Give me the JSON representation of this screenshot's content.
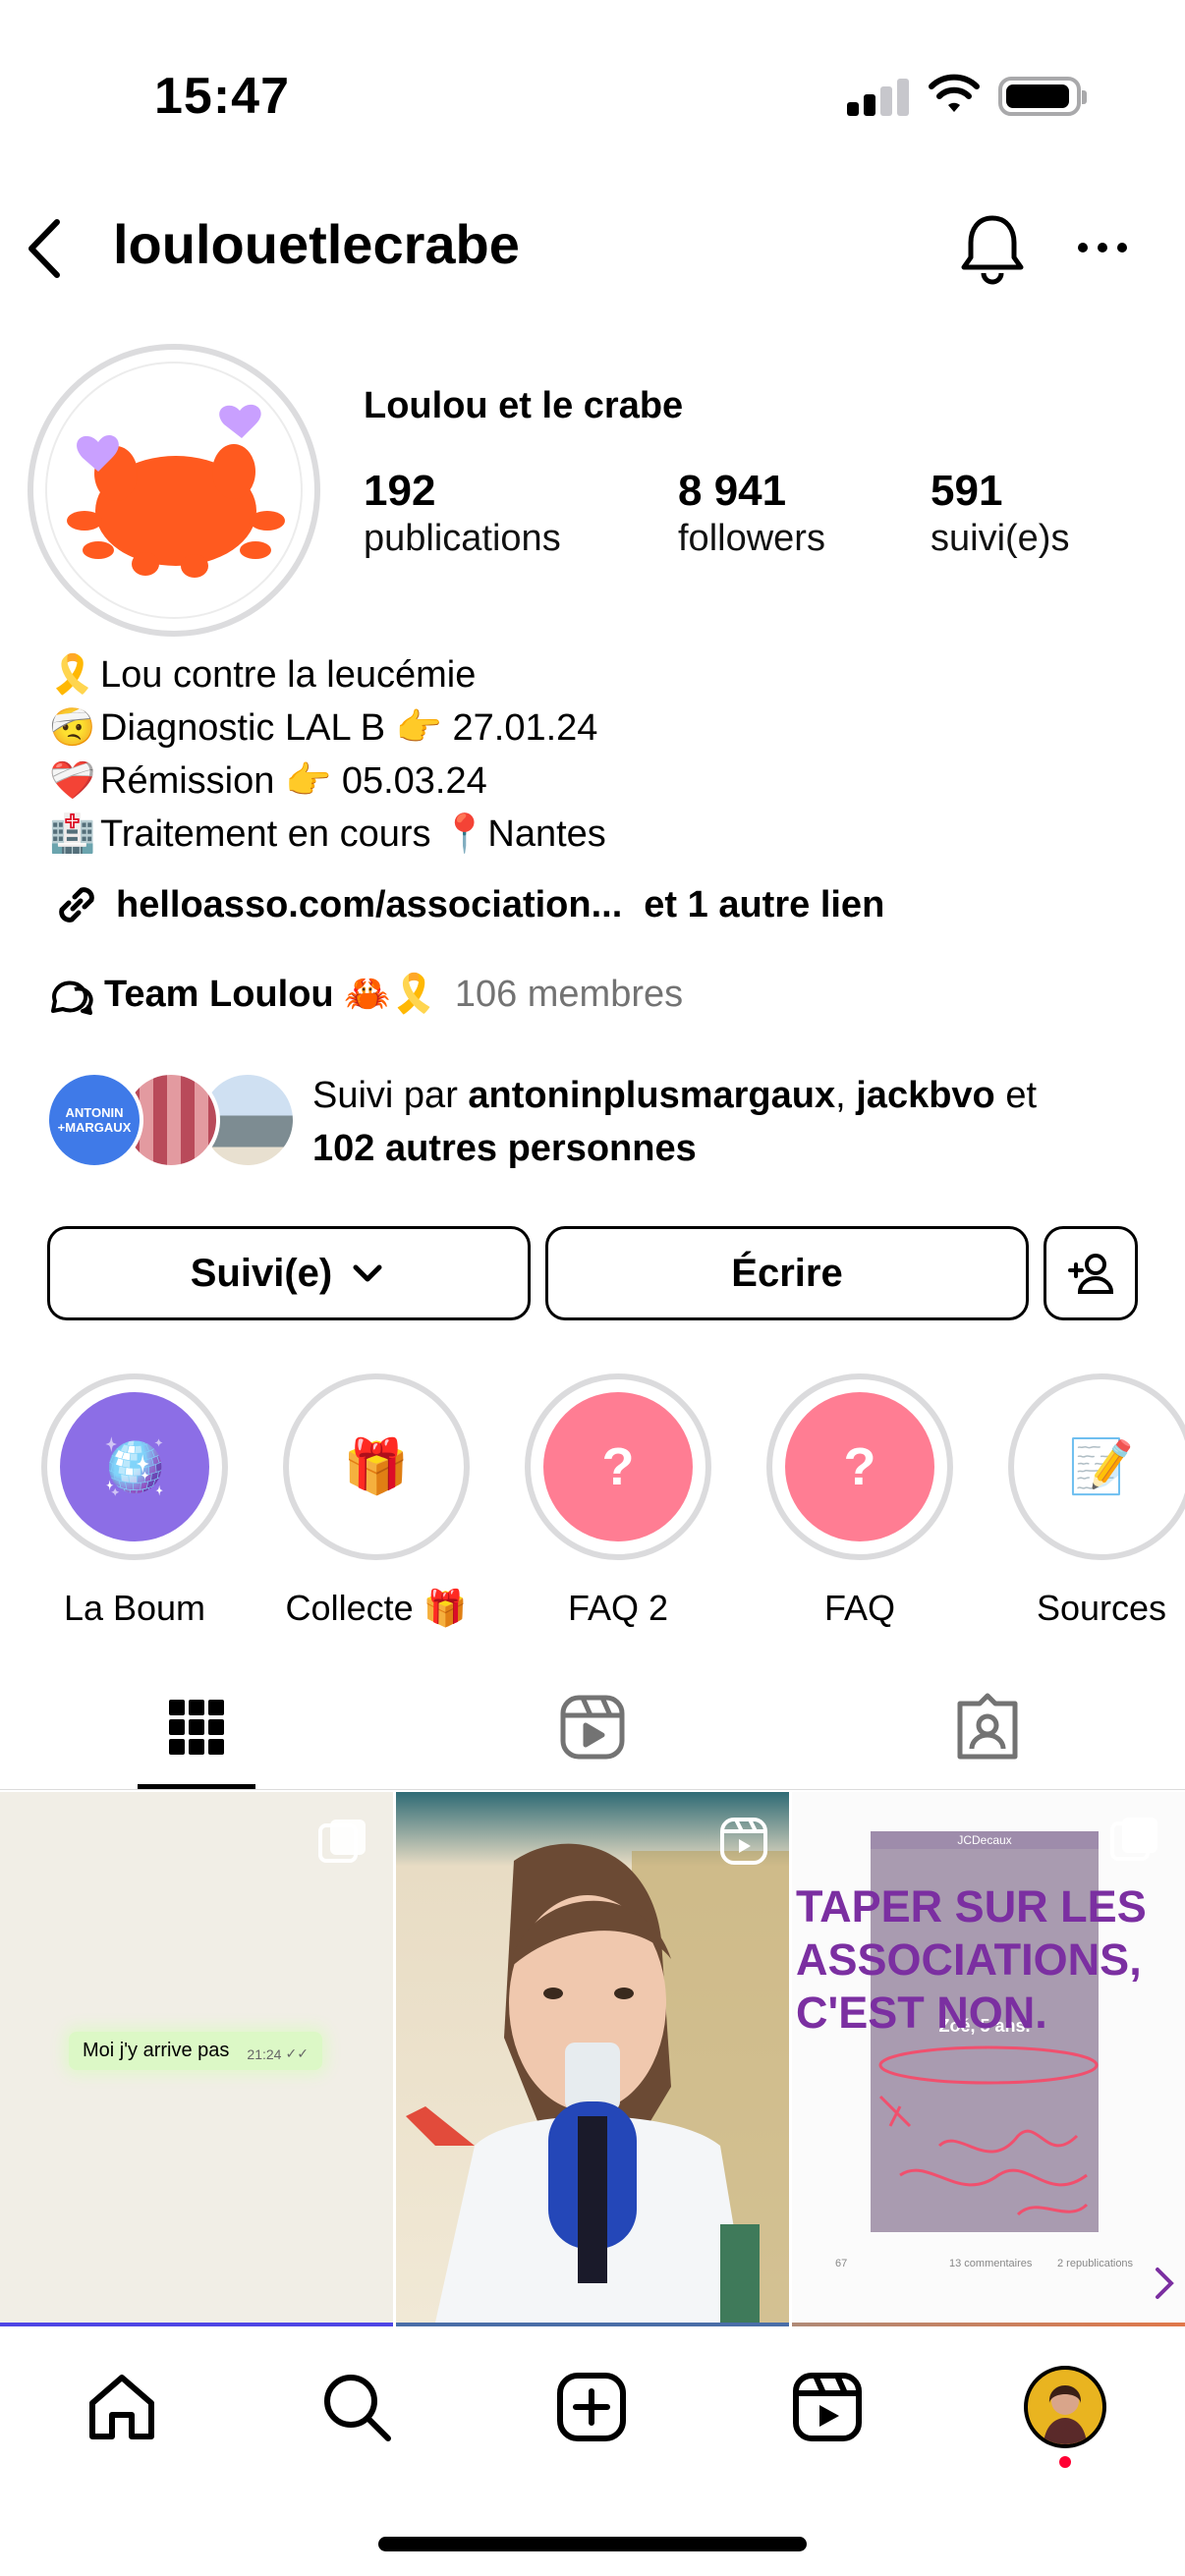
{
  "status_bar": {
    "time": "15:47"
  },
  "header": {
    "username": "loulouetlecrabe"
  },
  "profile": {
    "display_name": "Loulou et le crabe",
    "stats": [
      {
        "value": "192",
        "label": "publications"
      },
      {
        "value": "8 941",
        "label": "followers"
      },
      {
        "value": "591",
        "label": "suivi(e)s"
      }
    ],
    "bio": [
      {
        "emoji": "🎗️",
        "text": "Lou contre la leucémie"
      },
      {
        "emoji": "🤕",
        "text": "Diagnostic LAL B 👉 27.01.24"
      },
      {
        "emoji": "❤️‍🩹",
        "text": "Rémission 👉 05.03.24"
      },
      {
        "emoji": "🏥",
        "text": "Traitement en cours 📍Nantes"
      }
    ],
    "link": "helloasso.com/association...",
    "link_more": "et 1 autre lien",
    "community": {
      "name": "Team Loulou 🦀🎗️",
      "members": "106 membres"
    },
    "followed_by": {
      "prefix": "Suivi par ",
      "user1": "antoninplusmargaux",
      "sep": ", ",
      "user2": "jackbvo",
      "suffix": " et",
      "others": "102 autres personnes"
    },
    "follower_avatar_text": "ANTONIN\n+MARGAUX"
  },
  "buttons": {
    "following": "Suivi(e)",
    "message": "Écrire"
  },
  "highlights": [
    {
      "label": "La Boum",
      "icon": "🪩",
      "bg": "#8c6ee6"
    },
    {
      "label": "Collecte 🎁",
      "icon": "🎁",
      "bg": "#ffffff"
    },
    {
      "label": "FAQ 2",
      "icon": "?",
      "bg": "#ff7d93"
    },
    {
      "label": "FAQ",
      "icon": "?",
      "bg": "#ff7d93"
    },
    {
      "label": "Sources",
      "icon": "📝",
      "bg": "#ffffff"
    }
  ],
  "grid": {
    "post1": {
      "message": "Moi j'y arrive pas",
      "time": "21:24"
    },
    "post3": {
      "brand": "JCDecaux",
      "headline": "TAPER SUR LES ASSOCIATIONS, C'EST NON.",
      "caption": "Zoé, 5 ans.",
      "footer_left": "67",
      "footer_mid": "13 commentaires",
      "footer_right": "2 republications"
    }
  },
  "colors": {
    "accent_story": "#8c6ee6",
    "faq": "#ff7d93",
    "crab": "#ff5a1f",
    "heart": "#c9a0ff",
    "purple_text": "#7b2fa1",
    "notification_dot": "#ff0033"
  }
}
